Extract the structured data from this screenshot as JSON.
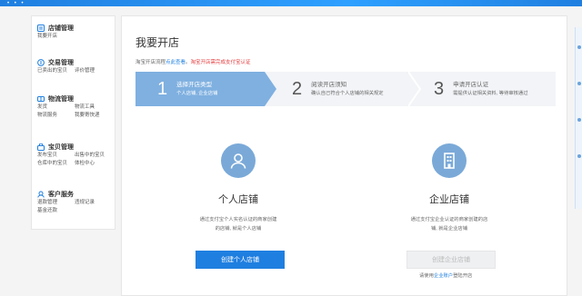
{
  "sidebar": {
    "groups": [
      {
        "title": "店铺管理",
        "icon": "store-icon",
        "items": [
          "我要开店"
        ]
      },
      {
        "title": "交易管理",
        "icon": "trade-icon",
        "items": [
          "已卖出的宝贝",
          "评价管理"
        ]
      },
      {
        "title": "物流管理",
        "icon": "truck-icon",
        "items": [
          "发货",
          "物流工具",
          "物流服务",
          "我要寄快递"
        ]
      },
      {
        "title": "宝贝管理",
        "icon": "bag-icon",
        "items": [
          "发布宝贝",
          "出售中的宝贝",
          "仓库中的宝贝",
          "体检中心"
        ]
      },
      {
        "title": "客户服务",
        "icon": "service-icon",
        "items": [
          "退款管理",
          "违规记录",
          "基金还款"
        ]
      }
    ]
  },
  "main": {
    "title": "我要开店",
    "notice": {
      "prefix": "淘宝开店流程",
      "link": "点此查看",
      "sep": "。",
      "warn": "淘宝开店需完成支付宝认证"
    },
    "steps": [
      {
        "num": "1",
        "title": "选择开店类型",
        "desc": "个人店铺, 企业店铺"
      },
      {
        "num": "2",
        "title": "阅读开店须知",
        "desc": "确认自己符合个人店铺的相关规定"
      },
      {
        "num": "3",
        "title": "申请开店认证",
        "desc": "需提供认证相关资料, 等待审核通过"
      }
    ],
    "personal": {
      "title": "个人店铺",
      "desc_line1": "通过支付宝个人实名认证的商家创建",
      "desc_line2": "的店铺, 就是个人店铺",
      "button": "创建个人店铺"
    },
    "company": {
      "title": "企业店铺",
      "desc_line1": "通过支付宝企业认证的商家创建的店",
      "desc_line2": "铺, 就是企业店铺",
      "button": "创建企业店铺",
      "tip_prefix": "请使用",
      "tip_link": "企业账户",
      "tip_suffix": "登陆开店"
    }
  },
  "colors": {
    "accent": "#1f7fe0",
    "warn": "#e4393c",
    "step_active": "#7fb0e0"
  }
}
